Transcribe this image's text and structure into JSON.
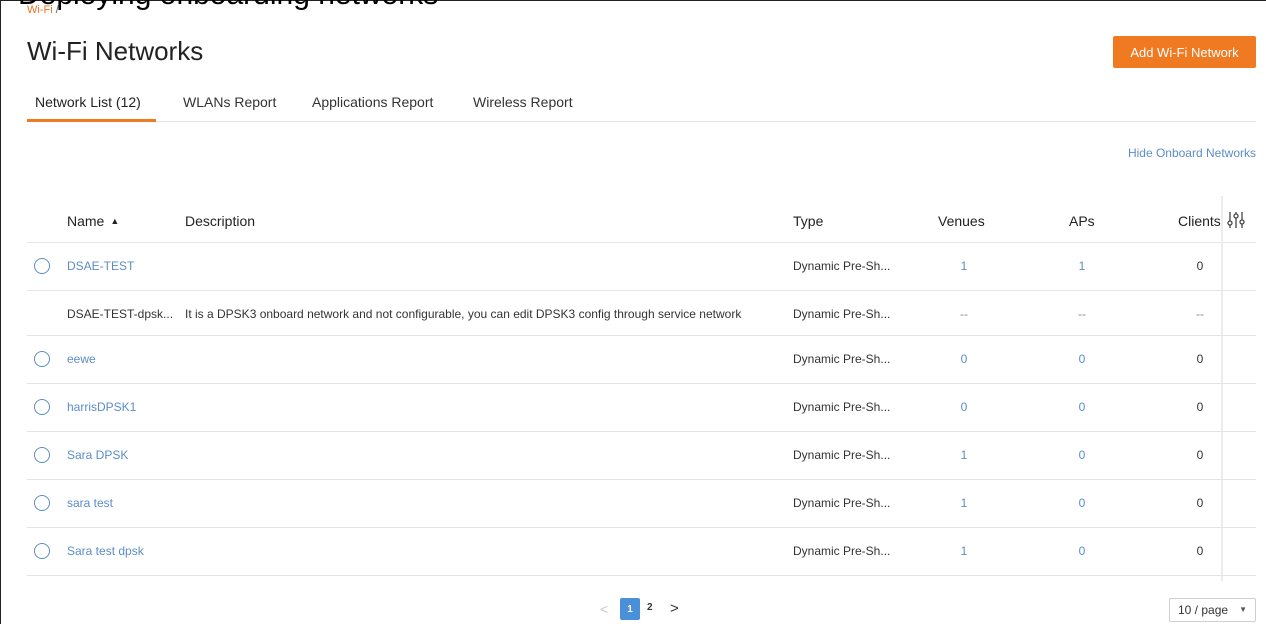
{
  "overlay_caption": "Deploying onboarding networks",
  "breadcrumb": {
    "link": "Wi-Fi",
    "separator": "/"
  },
  "page": {
    "title": "Wi-Fi Networks",
    "add_button": "Add Wi-Fi Network"
  },
  "tabs": [
    {
      "label": "Network List (12)",
      "active": true
    },
    {
      "label": "WLANs Report",
      "active": false
    },
    {
      "label": "Applications Report",
      "active": false
    },
    {
      "label": "Wireless Report",
      "active": false
    }
  ],
  "hide_onboard_link": "Hide Onboard Networks",
  "table": {
    "columns": {
      "name": "Name",
      "description": "Description",
      "type": "Type",
      "venues": "Venues",
      "aps": "APs",
      "clients": "Clients"
    },
    "rows": [
      {
        "name": "DSAE-TEST",
        "description": "",
        "type": "Dynamic Pre-Sh...",
        "venues": "1",
        "aps": "1",
        "clients": "0",
        "selectable": true
      },
      {
        "name": "DSAE-TEST-dpsk...",
        "description": "It is a DPSK3 onboard network and not configurable, you can edit DPSK3 config through service network",
        "type": "Dynamic Pre-Sh...",
        "venues": "--",
        "aps": "--",
        "clients": "--",
        "selectable": false
      },
      {
        "name": "eewe",
        "description": "",
        "type": "Dynamic Pre-Sh...",
        "venues": "0",
        "aps": "0",
        "clients": "0",
        "selectable": true
      },
      {
        "name": "harrisDPSK1",
        "description": "",
        "type": "Dynamic Pre-Sh...",
        "venues": "0",
        "aps": "0",
        "clients": "0",
        "selectable": true
      },
      {
        "name": "Sara DPSK",
        "description": "",
        "type": "Dynamic Pre-Sh...",
        "venues": "1",
        "aps": "0",
        "clients": "0",
        "selectable": true
      },
      {
        "name": "sara test",
        "description": "",
        "type": "Dynamic Pre-Sh...",
        "venues": "1",
        "aps": "0",
        "clients": "0",
        "selectable": true
      },
      {
        "name": "Sara test dpsk",
        "description": "",
        "type": "Dynamic Pre-Sh...",
        "venues": "1",
        "aps": "0",
        "clients": "0",
        "selectable": true
      }
    ]
  },
  "pagination": {
    "prev": "<",
    "pages": [
      "1",
      "2"
    ],
    "current": "1",
    "next": ">",
    "page_size": "10 / page"
  },
  "colors": {
    "accent": "#ef7a22",
    "link": "#5b8dc9",
    "active_page": "#4a90d9"
  }
}
